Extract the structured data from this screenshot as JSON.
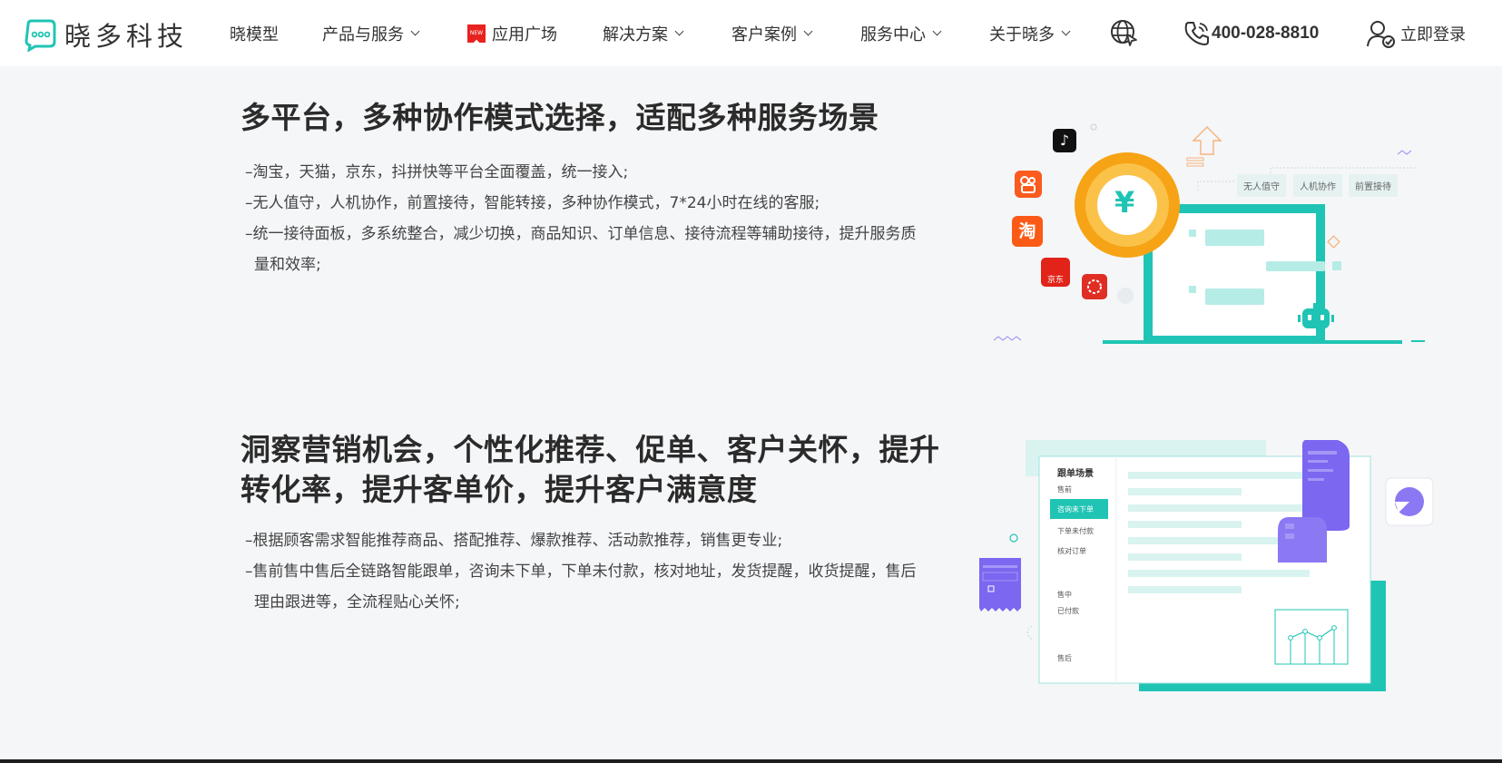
{
  "header": {
    "logo_text": "晓多科技",
    "nav": [
      {
        "label": "晓模型",
        "dropdown": false,
        "badge": null
      },
      {
        "label": "产品与服务",
        "dropdown": true,
        "badge": null
      },
      {
        "label": "应用广场",
        "dropdown": false,
        "badge": "NEW"
      },
      {
        "label": "解决方案",
        "dropdown": true,
        "badge": null
      },
      {
        "label": "客户案例",
        "dropdown": true,
        "badge": null
      },
      {
        "label": "服务中心",
        "dropdown": true,
        "badge": null
      },
      {
        "label": "关于晓多",
        "dropdown": true,
        "badge": null
      }
    ],
    "phone": "400-028-8810",
    "login_label": "立即登录"
  },
  "section1": {
    "title": "多平台，多种协作模式选择，适配多种服务场景",
    "bullets": [
      "–淘宝，天猫，京东，抖拼快等平台全面覆盖，统一接入;",
      "–无人值守，人机协作，前置接待，智能转接，多种协作模式，7*24小时在线的客服;",
      "–统一接待面板，多系统整合，减少切换，商品知识、订单信息、接待流程等辅助接待，提升服务质量和效率;"
    ],
    "illustration": {
      "tags": [
        "无人值守",
        "人机协作",
        "前置接待"
      ],
      "platform_icons": [
        {
          "name": "tiktok-icon",
          "label": ""
        },
        {
          "name": "kuaishou-icon",
          "label": ""
        },
        {
          "name": "taobao-icon",
          "label": "淘"
        },
        {
          "name": "jd-icon",
          "label": "京东"
        },
        {
          "name": "pinduoduo-icon",
          "label": ""
        }
      ],
      "coin_symbol": "¥"
    }
  },
  "section2": {
    "title_line1": "洞察营销机会，个性化推荐、促单、客户关怀，提升",
    "title_line2": "转化率，提升客单价，提升客户满意度",
    "bullets": [
      "–根据顾客需求智能推荐商品、搭配推荐、爆款推荐、活动款推荐，销售更专业;",
      "–售前售中售后全链路智能跟单，咨询未下单，下单未付款，核对地址，发货提醒，收货提醒，售后理由跟进等，全流程贴心关怀;"
    ],
    "illustration": {
      "panel_title": "跟单场景",
      "menu": [
        {
          "label": "售前",
          "active": false
        },
        {
          "label": "咨询未下单",
          "active": true
        },
        {
          "label": "下单未付款",
          "active": false
        },
        {
          "label": "核对订单",
          "active": false
        },
        {
          "label": "售中",
          "active": false
        },
        {
          "label": "已付款",
          "active": false
        },
        {
          "label": "售后",
          "active": false
        }
      ]
    }
  },
  "colors": {
    "accent": "#20c4b4",
    "accent_light": "#b6ece6",
    "orange": "#f6a316",
    "purple": "#7b67f0",
    "badge_red": "#e8231f"
  }
}
